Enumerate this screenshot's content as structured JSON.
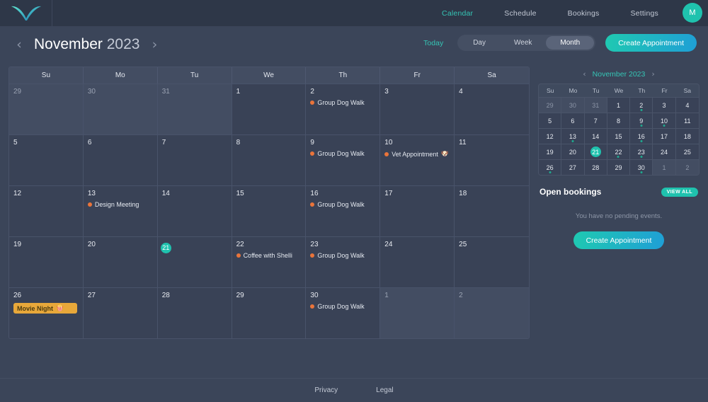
{
  "nav": {
    "logo_icon": "v-logo-icon",
    "links": [
      {
        "label": "Calendar",
        "active": true
      },
      {
        "label": "Schedule",
        "active": false
      },
      {
        "label": "Bookings",
        "active": false
      },
      {
        "label": "Settings",
        "active": false
      }
    ],
    "avatar_initial": "M"
  },
  "toolbar": {
    "prev_icon": "chevron-left-icon",
    "next_icon": "chevron-right-icon",
    "month": "November",
    "year": "2023",
    "today_label": "Today",
    "views": [
      {
        "label": "Day",
        "active": false
      },
      {
        "label": "Week",
        "active": false
      },
      {
        "label": "Month",
        "active": true
      }
    ],
    "create_label": "Create Appointment"
  },
  "calendar": {
    "dow": [
      "Su",
      "Mo",
      "Tu",
      "We",
      "Th",
      "Fr",
      "Sa"
    ],
    "today": 21,
    "weeks": [
      [
        {
          "n": "29",
          "out": true,
          "events": []
        },
        {
          "n": "30",
          "out": true,
          "events": []
        },
        {
          "n": "31",
          "out": true,
          "events": []
        },
        {
          "n": "1",
          "out": false,
          "events": []
        },
        {
          "n": "2",
          "out": false,
          "events": [
            {
              "label": "Group Dog Walk",
              "style": "dot",
              "color": "#e9743a",
              "emoji": ""
            }
          ]
        },
        {
          "n": "3",
          "out": false,
          "events": []
        },
        {
          "n": "4",
          "out": false,
          "events": []
        }
      ],
      [
        {
          "n": "5",
          "out": false,
          "events": []
        },
        {
          "n": "6",
          "out": false,
          "events": []
        },
        {
          "n": "7",
          "out": false,
          "events": []
        },
        {
          "n": "8",
          "out": false,
          "events": []
        },
        {
          "n": "9",
          "out": false,
          "events": [
            {
              "label": "Group Dog Walk",
              "style": "dot",
              "color": "#e9743a",
              "emoji": ""
            }
          ]
        },
        {
          "n": "10",
          "out": false,
          "events": [
            {
              "label": "Vet Appointment",
              "style": "dot",
              "color": "#e9743a",
              "emoji": "🐶"
            }
          ]
        },
        {
          "n": "11",
          "out": false,
          "events": []
        }
      ],
      [
        {
          "n": "12",
          "out": false,
          "events": []
        },
        {
          "n": "13",
          "out": false,
          "events": [
            {
              "label": "Design Meeting",
              "style": "dot",
              "color": "#e9743a",
              "emoji": ""
            }
          ]
        },
        {
          "n": "14",
          "out": false,
          "events": []
        },
        {
          "n": "15",
          "out": false,
          "events": []
        },
        {
          "n": "16",
          "out": false,
          "events": [
            {
              "label": "Group Dog Walk",
              "style": "dot",
              "color": "#e9743a",
              "emoji": ""
            }
          ]
        },
        {
          "n": "17",
          "out": false,
          "events": []
        },
        {
          "n": "18",
          "out": false,
          "events": []
        }
      ],
      [
        {
          "n": "19",
          "out": false,
          "events": []
        },
        {
          "n": "20",
          "out": false,
          "events": []
        },
        {
          "n": "21",
          "out": false,
          "today": true,
          "events": []
        },
        {
          "n": "22",
          "out": false,
          "events": [
            {
              "label": "Coffee with Shelli",
              "style": "dot",
              "color": "#e9743a",
              "emoji": ""
            }
          ]
        },
        {
          "n": "23",
          "out": false,
          "events": [
            {
              "label": "Group Dog Walk",
              "style": "dot",
              "color": "#e9743a",
              "emoji": ""
            }
          ]
        },
        {
          "n": "24",
          "out": false,
          "events": []
        },
        {
          "n": "25",
          "out": false,
          "events": []
        }
      ],
      [
        {
          "n": "26",
          "out": false,
          "events": [
            {
              "label": "Movie Night",
              "style": "pill",
              "color": "#e8a83a",
              "emoji": "🍿"
            }
          ]
        },
        {
          "n": "27",
          "out": false,
          "events": []
        },
        {
          "n": "28",
          "out": false,
          "events": []
        },
        {
          "n": "29",
          "out": false,
          "events": []
        },
        {
          "n": "30",
          "out": false,
          "events": [
            {
              "label": "Group Dog Walk",
              "style": "dot",
              "color": "#e9743a",
              "emoji": ""
            }
          ]
        },
        {
          "n": "1",
          "out": true,
          "events": []
        },
        {
          "n": "2",
          "out": true,
          "events": []
        }
      ]
    ]
  },
  "mini": {
    "prev_icon": "chevron-left-icon",
    "next_icon": "chevron-right-icon",
    "title": "November 2023",
    "dow": [
      "Su",
      "Mo",
      "Tu",
      "We",
      "Th",
      "Fr",
      "Sa"
    ],
    "weeks": [
      [
        {
          "n": "29",
          "out": true,
          "dot": false
        },
        {
          "n": "30",
          "out": true,
          "dot": false
        },
        {
          "n": "31",
          "out": true,
          "dot": false
        },
        {
          "n": "1",
          "out": false,
          "dot": false
        },
        {
          "n": "2",
          "out": false,
          "dot": true
        },
        {
          "n": "3",
          "out": false,
          "dot": false
        },
        {
          "n": "4",
          "out": false,
          "dot": false
        }
      ],
      [
        {
          "n": "5",
          "out": false,
          "dot": false
        },
        {
          "n": "6",
          "out": false,
          "dot": false
        },
        {
          "n": "7",
          "out": false,
          "dot": false
        },
        {
          "n": "8",
          "out": false,
          "dot": false
        },
        {
          "n": "9",
          "out": false,
          "dot": true
        },
        {
          "n": "10",
          "out": false,
          "dot": true
        },
        {
          "n": "11",
          "out": false,
          "dot": false
        }
      ],
      [
        {
          "n": "12",
          "out": false,
          "dot": false
        },
        {
          "n": "13",
          "out": false,
          "dot": true
        },
        {
          "n": "14",
          "out": false,
          "dot": false
        },
        {
          "n": "15",
          "out": false,
          "dot": false
        },
        {
          "n": "16",
          "out": false,
          "dot": true
        },
        {
          "n": "17",
          "out": false,
          "dot": false
        },
        {
          "n": "18",
          "out": false,
          "dot": false
        }
      ],
      [
        {
          "n": "19",
          "out": false,
          "dot": false
        },
        {
          "n": "20",
          "out": false,
          "dot": false
        },
        {
          "n": "21",
          "out": false,
          "dot": false,
          "today": true
        },
        {
          "n": "22",
          "out": false,
          "dot": true
        },
        {
          "n": "23",
          "out": false,
          "dot": true
        },
        {
          "n": "24",
          "out": false,
          "dot": false
        },
        {
          "n": "25",
          "out": false,
          "dot": false
        }
      ],
      [
        {
          "n": "26",
          "out": false,
          "dot": true
        },
        {
          "n": "27",
          "out": false,
          "dot": false
        },
        {
          "n": "28",
          "out": false,
          "dot": false
        },
        {
          "n": "29",
          "out": false,
          "dot": false
        },
        {
          "n": "30",
          "out": false,
          "dot": true
        },
        {
          "n": "1",
          "out": true,
          "dot": false
        },
        {
          "n": "2",
          "out": true,
          "dot": false
        }
      ]
    ]
  },
  "open_bookings": {
    "title": "Open bookings",
    "view_all_label": "VIEW ALL",
    "empty_text": "You have no pending events.",
    "create_label": "Create Appointment"
  },
  "footer": {
    "links": [
      {
        "label": "Privacy"
      },
      {
        "label": "Legal"
      }
    ]
  },
  "colors": {
    "accent": "#1fc2ae",
    "accent_blue": "#1f9fd6",
    "event_dot": "#e9743a",
    "event_pill": "#e8a83a",
    "bg": "#3b4559",
    "nav_bg": "#2e3748",
    "cell_bg": "#394257",
    "cell_out_bg": "#434d62"
  }
}
